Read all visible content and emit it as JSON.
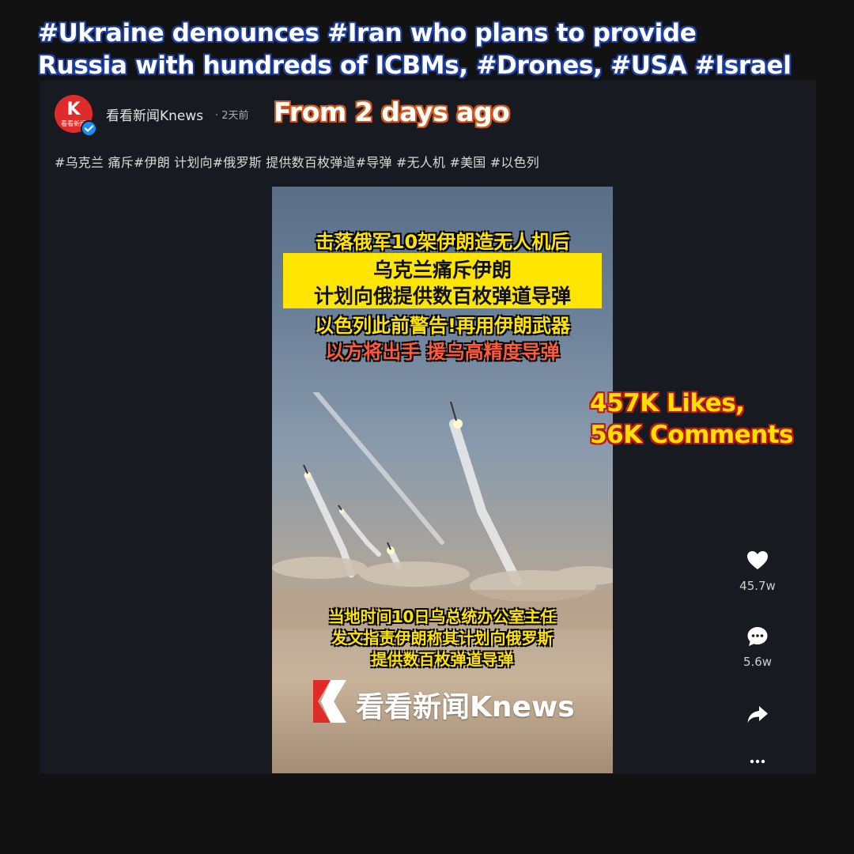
{
  "overlay": {
    "headline_line1": "#Ukraine denounces #Iran who plans to provide",
    "headline_line2": "Russia with hundreds of ICBMs, #Drones, #USA #Israel",
    "days_ago": "From 2 days ago",
    "stats_line1": "457K Likes,",
    "stats_line2": "56K Comments"
  },
  "post": {
    "avatar_text": "看看新闻",
    "account_name": "看看新闻Knews",
    "time": "· 2天前",
    "caption": "#乌克兰 痛斥#伊朗 计划向#俄罗斯 提供数百枚弹道#导弹 #无人机 #美国 #以色列"
  },
  "video": {
    "title_line1": "击落俄军10架伊朗造无人机后",
    "title_line2": "乌克兰痛斥伊朗",
    "title_line3": "计划向俄提供数百枚弹道导弹",
    "title_line4": "以色列此前警告!再用伊朗武器",
    "title_line5": "以方将出手  援乌高精度导弹",
    "subtitle_line1": "当地时间10日乌总统办公室主任",
    "subtitle_line2": "发文指责伊朗称其计划向俄罗斯",
    "subtitle_line3": "提供数百枚弹道导弹",
    "logo_text": "看看新闻Knews"
  },
  "actions": {
    "like_count": "45.7w",
    "comment_count": "5.6w"
  },
  "icons": [
    "heart-icon",
    "comment-icon",
    "share-icon",
    "more-icon",
    "verified-icon"
  ],
  "colors": {
    "brand_red": "#e02b2b",
    "background": "#121212",
    "panel": "#171a21",
    "overlay_yellow": "#ffe000"
  }
}
